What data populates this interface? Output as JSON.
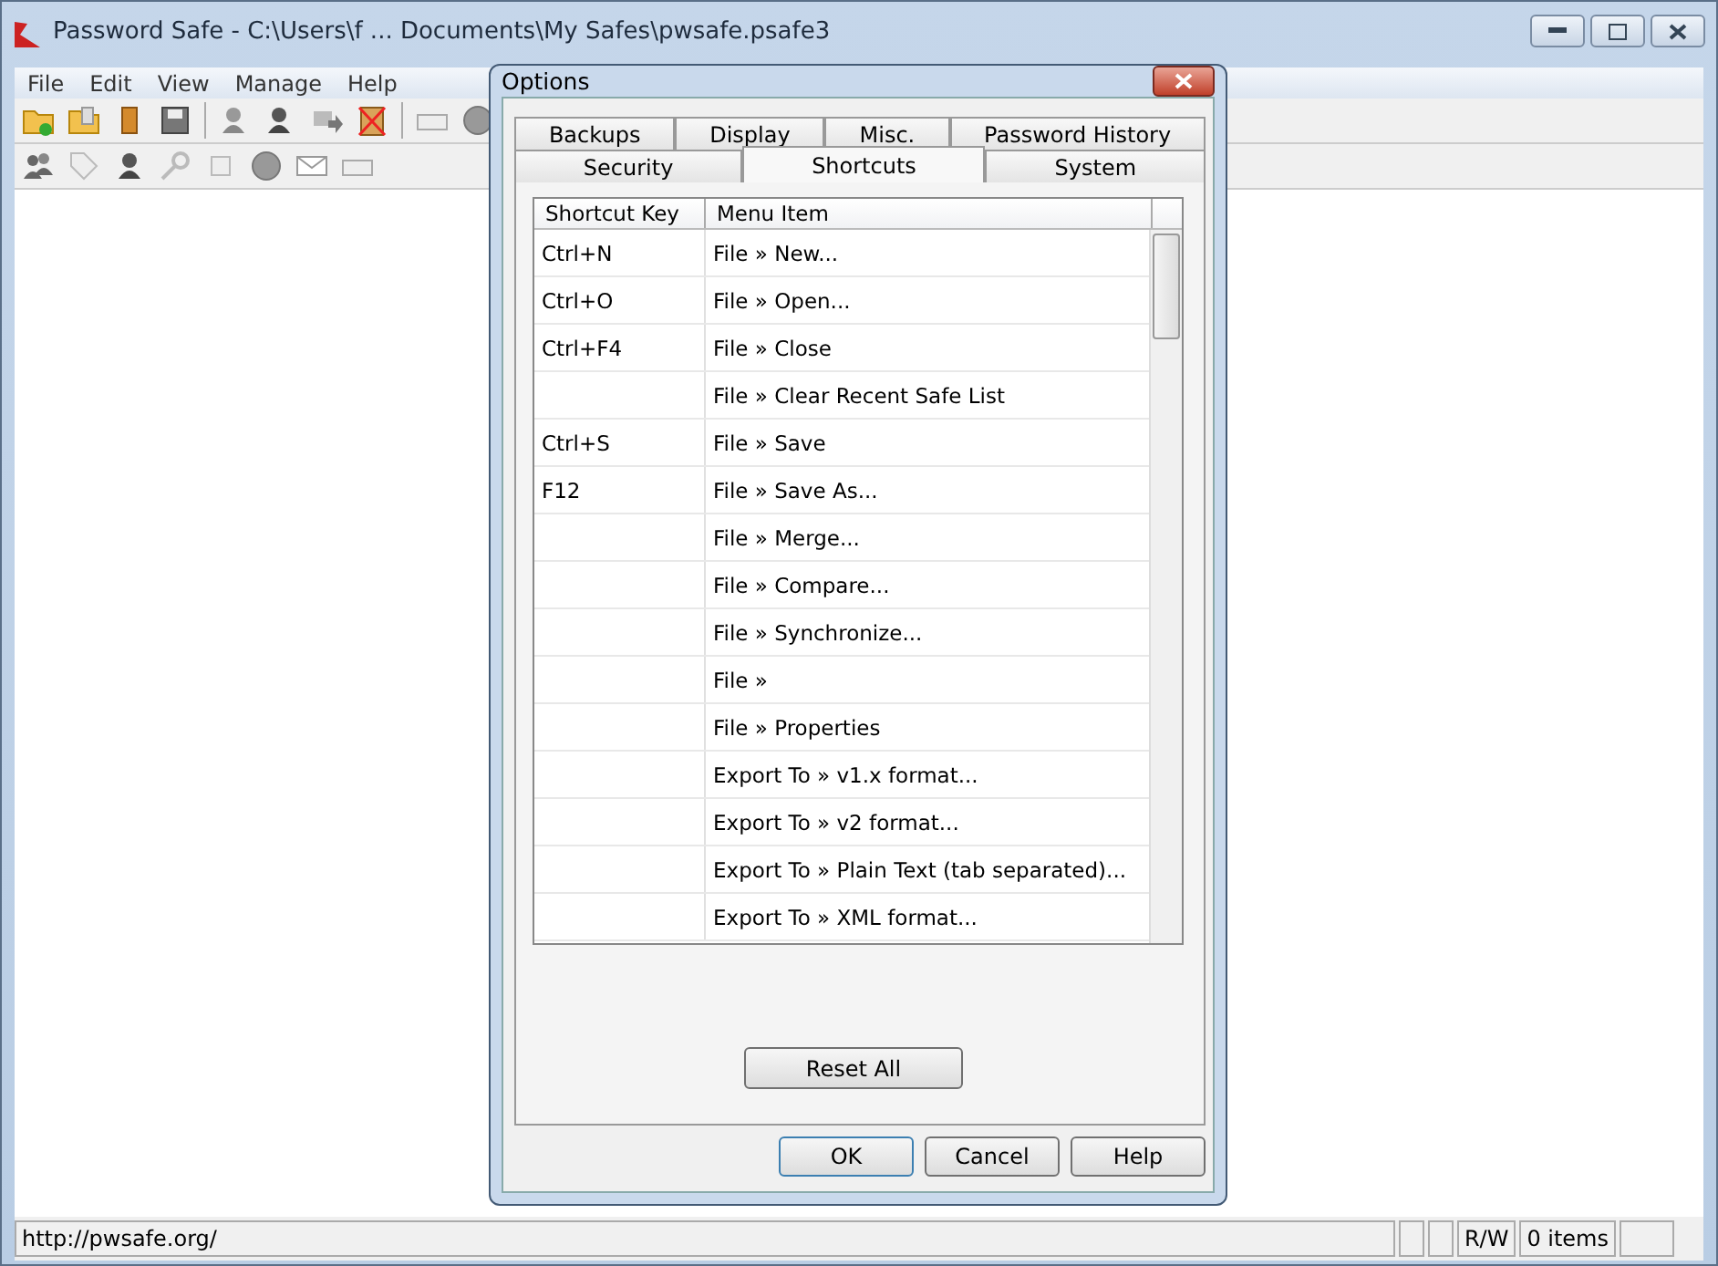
{
  "window": {
    "title": "Password Safe - C:\\Users\\f ... Documents\\My Safes\\pwsafe.psafe3"
  },
  "menu": [
    "File",
    "Edit",
    "View",
    "Manage",
    "Help"
  ],
  "dialog": {
    "title": "Options",
    "tab_rows": [
      [
        {
          "label": "Backups",
          "selected": false
        },
        {
          "label": "Display",
          "selected": false
        },
        {
          "label": "Misc.",
          "selected": false
        },
        {
          "label": "Password History",
          "selected": false
        }
      ],
      [
        {
          "label": "Security",
          "selected": false
        },
        {
          "label": "Shortcuts",
          "selected": true
        },
        {
          "label": "System",
          "selected": false
        }
      ]
    ],
    "table": {
      "columns": [
        "Shortcut Key",
        "Menu Item"
      ],
      "rows": [
        {
          "key": "Ctrl+N",
          "item": "File » New..."
        },
        {
          "key": "Ctrl+O",
          "item": "File » Open..."
        },
        {
          "key": "Ctrl+F4",
          "item": "File » Close"
        },
        {
          "key": "",
          "item": "File » Clear Recent Safe List"
        },
        {
          "key": "Ctrl+S",
          "item": "File » Save"
        },
        {
          "key": "F12",
          "item": "File » Save As..."
        },
        {
          "key": "",
          "item": "File » Merge..."
        },
        {
          "key": "",
          "item": "File » Compare..."
        },
        {
          "key": "",
          "item": "File » Synchronize..."
        },
        {
          "key": "",
          "item": "File »"
        },
        {
          "key": "",
          "item": "File » Properties"
        },
        {
          "key": "",
          "item": "Export To » v1.x format..."
        },
        {
          "key": "",
          "item": "Export To » v2 format..."
        },
        {
          "key": "",
          "item": "Export To » Plain Text (tab separated)..."
        },
        {
          "key": "",
          "item": "Export To » XML format..."
        }
      ]
    },
    "reset_button": "Reset All",
    "buttons": [
      "OK",
      "Cancel",
      "Help"
    ]
  },
  "status_bar": {
    "url": "http://pwsafe.org/",
    "mode": "R/W",
    "count": "0 items"
  }
}
